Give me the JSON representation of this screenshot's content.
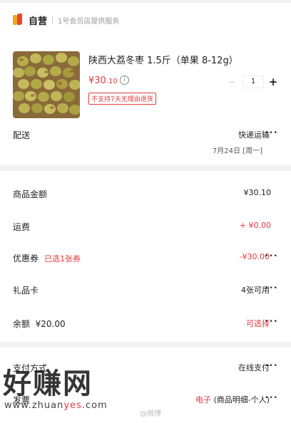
{
  "store": {
    "name": "自营",
    "desc": "1号会员店提供服务"
  },
  "product": {
    "title": "陕西大荔冬枣 1.5斤（单果 8-12g）",
    "price_main": "¥30",
    "price_decimal": ".10",
    "quantity": "1",
    "minus": "−",
    "plus": "+",
    "no_return": "不支持7天无理由退货"
  },
  "delivery": {
    "label": "配送",
    "method": "快递运输",
    "date": "7月24日 [周一]"
  },
  "summary": {
    "goods_label": "商品金额",
    "goods_value": "¥30.10",
    "shipping_label": "运费",
    "shipping_value": "+ ¥0.00",
    "coupon_label": "优惠券",
    "coupon_selected": "已选1张券",
    "coupon_value": "-¥30.00",
    "giftcard_label": "礼品卡",
    "giftcard_value": "4张可用",
    "balance_label": "余额",
    "balance_amount": "¥20.00",
    "balance_value": "可选择"
  },
  "payment": {
    "label": "支付方式",
    "value": "在线支付",
    "invoice_label": "发票",
    "invoice_type": "电子",
    "invoice_detail": "(商品明细-个人)"
  },
  "watermark": {
    "text": "好赚网",
    "url_prefix": "www.zhuan",
    "url_highlight": "yes",
    "url_suffix": ".com",
    "weibo": "@微博"
  },
  "colors": {
    "accent": "#e4393c",
    "logo_orange": "#f5a623"
  },
  "icons": [
    "store-logo-icon",
    "info-icon",
    "more-dots-icon"
  ]
}
